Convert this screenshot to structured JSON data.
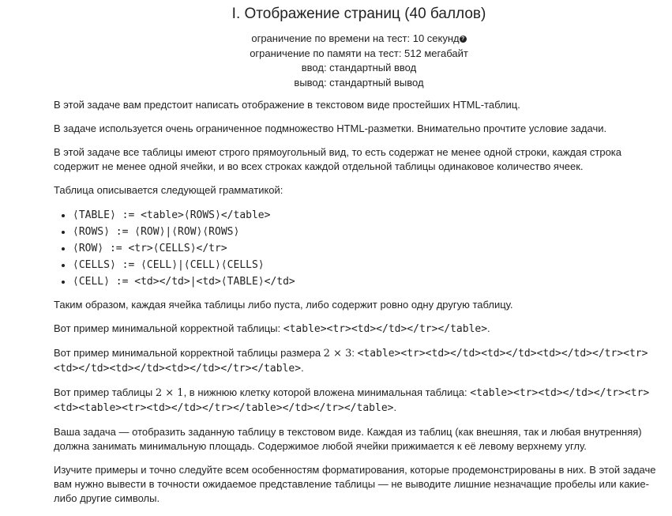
{
  "header": {
    "title": "I. Отображение страниц (40 баллов)",
    "time_limit": "ограничение по времени на тест: 10 секунд",
    "help_icon": "question-circle-icon",
    "memory_limit": "ограничение по памяти на тест: 512 мегабайт",
    "input": "ввод: стандартный ввод",
    "output": "вывод: стандартный вывод"
  },
  "statement": {
    "p1": "В этой задаче вам предстоит написать отображение в текстовом виде простейших HTML-таблиц.",
    "p2": "В задаче используется очень ограниченное подмножество HTML-разметки. Внимательно прочтите условие задачи.",
    "p3": "В этой задаче все таблицы имеют строго прямоугольный вид, то есть содержат не менее одной строки, каждая строка содержит не менее одной ячейки, и во всех строках каждой отдельной таблицы одинаковое количество ячеек.",
    "p4": "Таблица описывается следующей грамматикой:",
    "grammar": [
      "⟨TABLE⟩ := <table>⟨ROWS⟩</table>",
      "⟨ROWS⟩ := ⟨ROW⟩|⟨ROW⟩⟨ROWS⟩",
      "⟨ROW⟩ := <tr>⟨CELLS⟩</tr>",
      "⟨CELLS⟩ := ⟨CELL⟩|⟨CELL⟩⟨CELLS⟩",
      "⟨CELL⟩ := <td></td>|<td>⟨TABLE⟩</td>"
    ],
    "p5": "Таким образом, каждая ячейка таблицы либо пуста, либо содержит ровно одну другую таблицу.",
    "p6_text": "Вот пример минимальной корректной таблицы: ",
    "p6_code": "<table><tr><td></td></tr></table>",
    "p6_end": ".",
    "p7_text": "Вот пример минимальной корректной таблицы размера ",
    "p7_math": "2 × 3",
    "p7_colon": ": ",
    "p7_code": "<table><tr><td></td><td></td><td></td></tr><tr><td></td><td></td><td></td></tr></table>",
    "p7_end": ".",
    "p8_text": "Вот пример таблицы ",
    "p8_math": "2 × 1",
    "p8_text2": ", в нижнюю клетку которой вложена минимальная таблица: ",
    "p8_code": "<table><tr><td></td></tr><tr><td><table><tr><td></td></tr></table></td></tr></table>",
    "p8_end": ".",
    "p9": "Ваша задача — отобразить заданную таблицу в текстовом виде. Каждая из таблиц (как внешняя, так и любая внутренняя) должна занимать минимальную площадь. Содержимое любой ячейки прижимается к её левому верхнему углу.",
    "p10": "Изучите примеры и точно следуйте всем особенностям форматирования, которые продемонстрированы в них. В этой задаче вам нужно вывести в точности ожидаемое представление таблицы — не выводите лишние незначащие пробелы или какие-либо другие символы."
  }
}
